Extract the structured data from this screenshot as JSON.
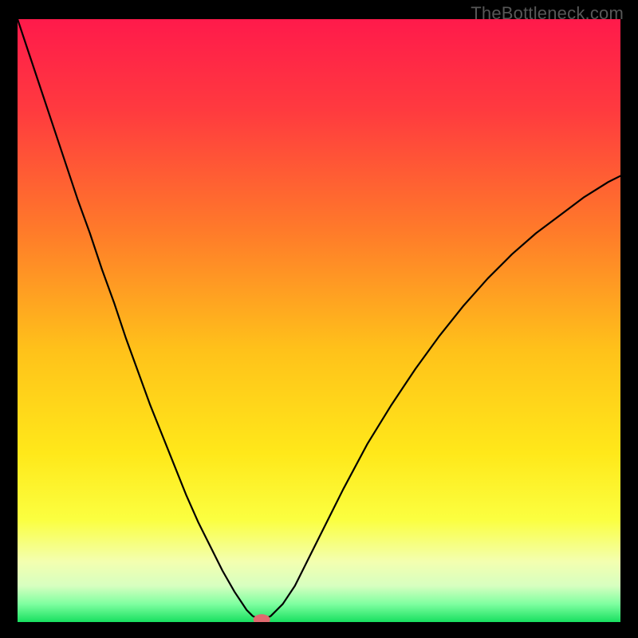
{
  "watermark": "TheBottleneck.com",
  "chart_data": {
    "type": "line",
    "title": "",
    "xlabel": "",
    "ylabel": "",
    "xlim": [
      0,
      100
    ],
    "ylim": [
      0,
      100
    ],
    "background_gradient": {
      "stops": [
        {
          "offset": 0.0,
          "color": "#ff1a4b"
        },
        {
          "offset": 0.15,
          "color": "#ff3a3f"
        },
        {
          "offset": 0.35,
          "color": "#ff7a2a"
        },
        {
          "offset": 0.55,
          "color": "#ffc21a"
        },
        {
          "offset": 0.72,
          "color": "#ffe81a"
        },
        {
          "offset": 0.83,
          "color": "#fbff40"
        },
        {
          "offset": 0.9,
          "color": "#f3ffb0"
        },
        {
          "offset": 0.94,
          "color": "#d7ffc0"
        },
        {
          "offset": 0.97,
          "color": "#7fffa0"
        },
        {
          "offset": 1.0,
          "color": "#18e060"
        }
      ]
    },
    "series": [
      {
        "name": "bottleneck-curve",
        "color": "#000000",
        "x": [
          0.0,
          2.0,
          4.0,
          6.0,
          8.0,
          10.0,
          12.0,
          14.0,
          16.0,
          18.0,
          20.0,
          22.0,
          24.0,
          26.0,
          28.0,
          30.0,
          32.0,
          34.0,
          36.0,
          37.0,
          38.0,
          39.0,
          40.0,
          41.0,
          42.0,
          44.0,
          46.0,
          48.0,
          50.0,
          54.0,
          58.0,
          62.0,
          66.0,
          70.0,
          74.0,
          78.0,
          82.0,
          86.0,
          90.0,
          94.0,
          98.0,
          100.0
        ],
        "y": [
          100.0,
          94.0,
          88.0,
          82.0,
          76.0,
          70.0,
          64.5,
          58.5,
          53.0,
          47.0,
          41.5,
          36.0,
          31.0,
          26.0,
          21.0,
          16.5,
          12.5,
          8.5,
          5.0,
          3.5,
          2.0,
          1.0,
          0.5,
          0.5,
          1.0,
          3.0,
          6.0,
          10.0,
          14.0,
          22.0,
          29.5,
          36.0,
          42.0,
          47.5,
          52.5,
          57.0,
          61.0,
          64.5,
          67.5,
          70.5,
          73.0,
          74.0
        ]
      }
    ],
    "marker": {
      "x": 40.5,
      "y": 0.4,
      "color": "#e06a6f",
      "rx": 1.4,
      "ry": 0.9
    }
  }
}
